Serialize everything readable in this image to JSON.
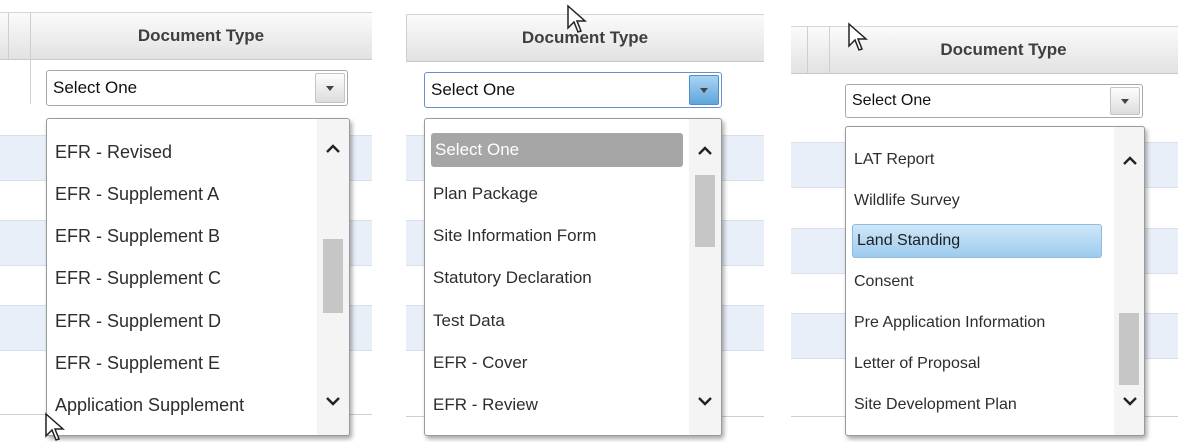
{
  "panels": [
    {
      "header": "Document Type",
      "select_value": "Select One",
      "items": [
        "EFR - Revised",
        "EFR - Supplement A",
        "EFR - Supplement B",
        "EFR - Supplement C",
        "EFR - Supplement D",
        "EFR - Supplement E",
        "Application Supplement"
      ],
      "selected_index": null
    },
    {
      "header": "Document Type",
      "select_value": "Select One",
      "items": [
        "Select One",
        "Plan Package",
        "Site Information Form",
        "Statutory Declaration",
        "Test Data",
        "EFR - Cover",
        "EFR - Review"
      ],
      "selected_index": 0
    },
    {
      "header": "Document Type",
      "select_value": "Select One",
      "items": [
        "LAT Report",
        "Wildlife Survey",
        "Land Standing",
        "Consent",
        "Pre Application Information",
        "Letter of Proposal",
        "Site Development Plan"
      ],
      "selected_index": 2
    }
  ],
  "scroll_position": [
    0.55,
    0.0,
    0.8
  ],
  "icons": {
    "scroll_up": "chevron-up-icon",
    "scroll_down": "chevron-down-icon",
    "dropdown": "caret-down-icon",
    "pointer": "mouse-cursor-icon"
  },
  "colors": {
    "header_bg": "#e6e6e6",
    "row_band": "#e9eff9",
    "selected_gray": "#a6a6a6",
    "selected_blue": "#a9d2f0",
    "dropdown_blue": "#5ea6dd"
  }
}
